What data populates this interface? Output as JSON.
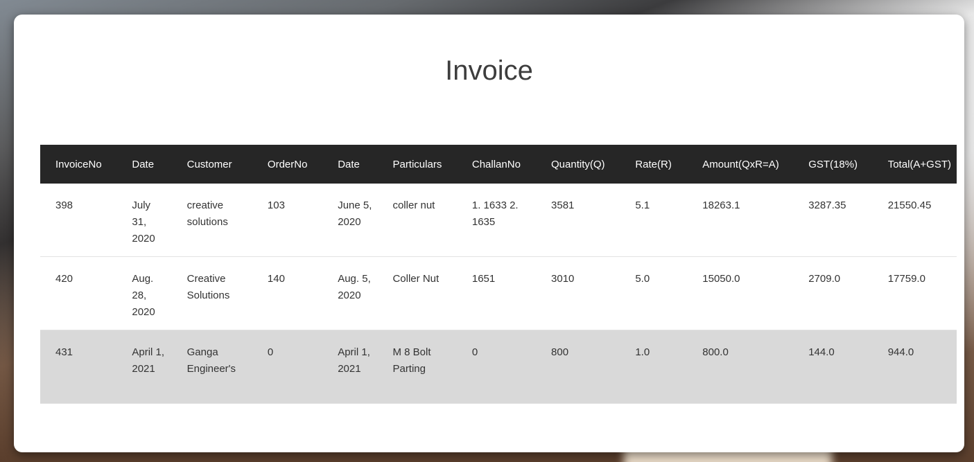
{
  "page": {
    "title": "Invoice"
  },
  "table": {
    "headers": [
      "InvoiceNo",
      "Date",
      "Customer",
      "OrderNo",
      "Date",
      "Particulars",
      "ChallanNo",
      "Quantity(Q)",
      "Rate(R)",
      "Amount(QxR=A)",
      "GST(18%)",
      "Total(A+GST)"
    ],
    "rows": [
      [
        "398",
        "July 31, 2020",
        "creative solutions",
        "103",
        "June 5, 2020",
        "coller nut",
        "1. 1633 2. 1635",
        "3581",
        "5.1",
        "18263.1",
        "3287.35",
        "21550.45"
      ],
      [
        "420",
        "Aug. 28, 2020",
        "Creative Solutions",
        "140",
        "Aug. 5, 2020",
        "Coller Nut",
        "1651",
        "3010",
        "5.0",
        "15050.0",
        "2709.0",
        "17759.0"
      ],
      [
        "431",
        "April 1, 2021",
        "Ganga Engineer's",
        "0",
        "April 1, 2021",
        "M 8 Bolt Parting",
        "0",
        "800",
        "1.0",
        "800.0",
        "144.0",
        "944.0"
      ]
    ]
  },
  "colors": {
    "header_bg": "#262626",
    "header_text": "#ffffff",
    "highlight_row": "#d9d9d9"
  }
}
